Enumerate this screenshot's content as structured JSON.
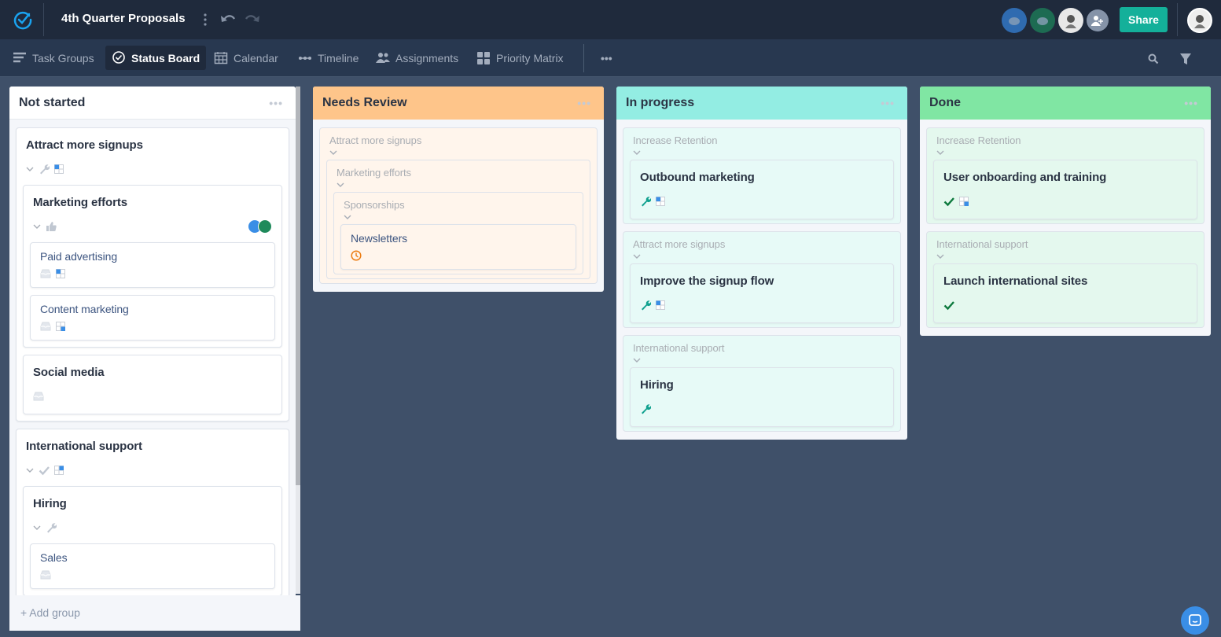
{
  "app": {
    "title": "4th Quarter Proposals",
    "share_label": "Share",
    "icons": [
      "app-logo-icon",
      "more-vertical-icon",
      "undo-icon",
      "redo-icon"
    ]
  },
  "collaborators": [
    {
      "name": "butterfly-avatar",
      "color": "#2f6bb0"
    },
    {
      "name": "frog-avatar",
      "color": "#1d6b52"
    },
    {
      "name": "user-photo-avatar",
      "color": "#e8e8e8"
    },
    {
      "name": "add-collaborator",
      "color": "#8593a8"
    }
  ],
  "tabs": [
    {
      "label": "Task Groups",
      "icon": "list-icon"
    },
    {
      "label": "Status Board",
      "icon": "check-circle-icon",
      "active": true
    },
    {
      "label": "Calendar",
      "icon": "calendar-icon"
    },
    {
      "label": "Timeline",
      "icon": "timeline-icon"
    },
    {
      "label": "Assignments",
      "icon": "people-icon"
    },
    {
      "label": "Priority Matrix",
      "icon": "grid-icon"
    }
  ],
  "colors": {
    "accent": "#14b09a"
  },
  "columns": [
    {
      "title": "Not started",
      "header": "#ffffff",
      "card_bg": "#ffffff",
      "cards": [
        {
          "title": "Attract more signups",
          "kind": "group",
          "icons": [
            "chevron-down",
            "wrench-gray",
            "matrix-0"
          ],
          "children": [
            {
              "title": "Marketing efforts",
              "kind": "group",
              "icons": [
                "chevron-down",
                "thumbs-up"
              ],
              "avatars": [
                "#3a8ee6",
                "#1f8a5b"
              ],
              "children": [
                {
                  "title": "Paid advertising",
                  "kind": "task",
                  "icons": [
                    "inbox",
                    "matrix-0"
                  ]
                },
                {
                  "title": "Content marketing",
                  "kind": "task",
                  "icons": [
                    "inbox",
                    "matrix-3"
                  ]
                }
              ]
            },
            {
              "title": "Social media",
              "kind": "group",
              "icons": [
                "inbox"
              ]
            }
          ]
        },
        {
          "title": "International support",
          "kind": "group",
          "icons": [
            "chevron-down",
            "check-gray",
            "matrix-1"
          ],
          "children": [
            {
              "title": "Hiring",
              "kind": "group",
              "icons": [
                "chevron-down",
                "wrench-gray"
              ],
              "children": [
                {
                  "title": "Sales",
                  "kind": "task",
                  "icons": [
                    "inbox"
                  ]
                }
              ]
            }
          ]
        }
      ],
      "footer": "+ Add group"
    },
    {
      "title": "Needs Review",
      "header": "#fec58a",
      "card_bg": "#fff5ec",
      "cards": [
        {
          "title": "Attract more signups",
          "kind": "ctx",
          "icons": [
            "chevron-down"
          ],
          "children": [
            {
              "title": "Marketing efforts",
              "kind": "ctx",
              "icons": [
                "chevron-down"
              ],
              "children": [
                {
                  "title": "Sponsorships",
                  "kind": "ctx",
                  "icons": [
                    "chevron-down"
                  ],
                  "children": [
                    {
                      "title": "Newsletters",
                      "kind": "task",
                      "icons": [
                        "clock"
                      ]
                    }
                  ]
                }
              ]
            }
          ]
        }
      ]
    },
    {
      "title": "In progress",
      "header": "#93ede3",
      "card_bg": "#e7faf7",
      "cards": [
        {
          "title": "Increase Retention",
          "kind": "ctx",
          "icons": [
            "chevron-down"
          ],
          "children": [
            {
              "title": "Outbound marketing",
              "kind": "group",
              "icons": [
                "wrench-teal",
                "matrix-0"
              ]
            }
          ]
        },
        {
          "title": "Attract more signups",
          "kind": "ctx",
          "icons": [
            "chevron-down"
          ],
          "children": [
            {
              "title": "Improve the signup flow",
              "kind": "group",
              "icons": [
                "wrench-teal",
                "matrix-0"
              ]
            }
          ]
        },
        {
          "title": "International support",
          "kind": "ctx",
          "icons": [
            "chevron-down"
          ],
          "children": [
            {
              "title": "Hiring",
              "kind": "group",
              "icons": [
                "wrench-teal"
              ]
            }
          ]
        }
      ]
    },
    {
      "title": "Done",
      "header": "#80e6a3",
      "card_bg": "#e4f8ee",
      "cards": [
        {
          "title": "Increase Retention",
          "kind": "ctx",
          "icons": [
            "chevron-down"
          ],
          "children": [
            {
              "title": "User onboarding and training",
              "kind": "group",
              "icons": [
                "check-green",
                "matrix-3"
              ]
            }
          ]
        },
        {
          "title": "International support",
          "kind": "ctx",
          "icons": [
            "chevron-down"
          ],
          "children": [
            {
              "title": "Launch international sites",
              "kind": "group",
              "icons": [
                "check-green"
              ]
            }
          ]
        }
      ]
    }
  ]
}
